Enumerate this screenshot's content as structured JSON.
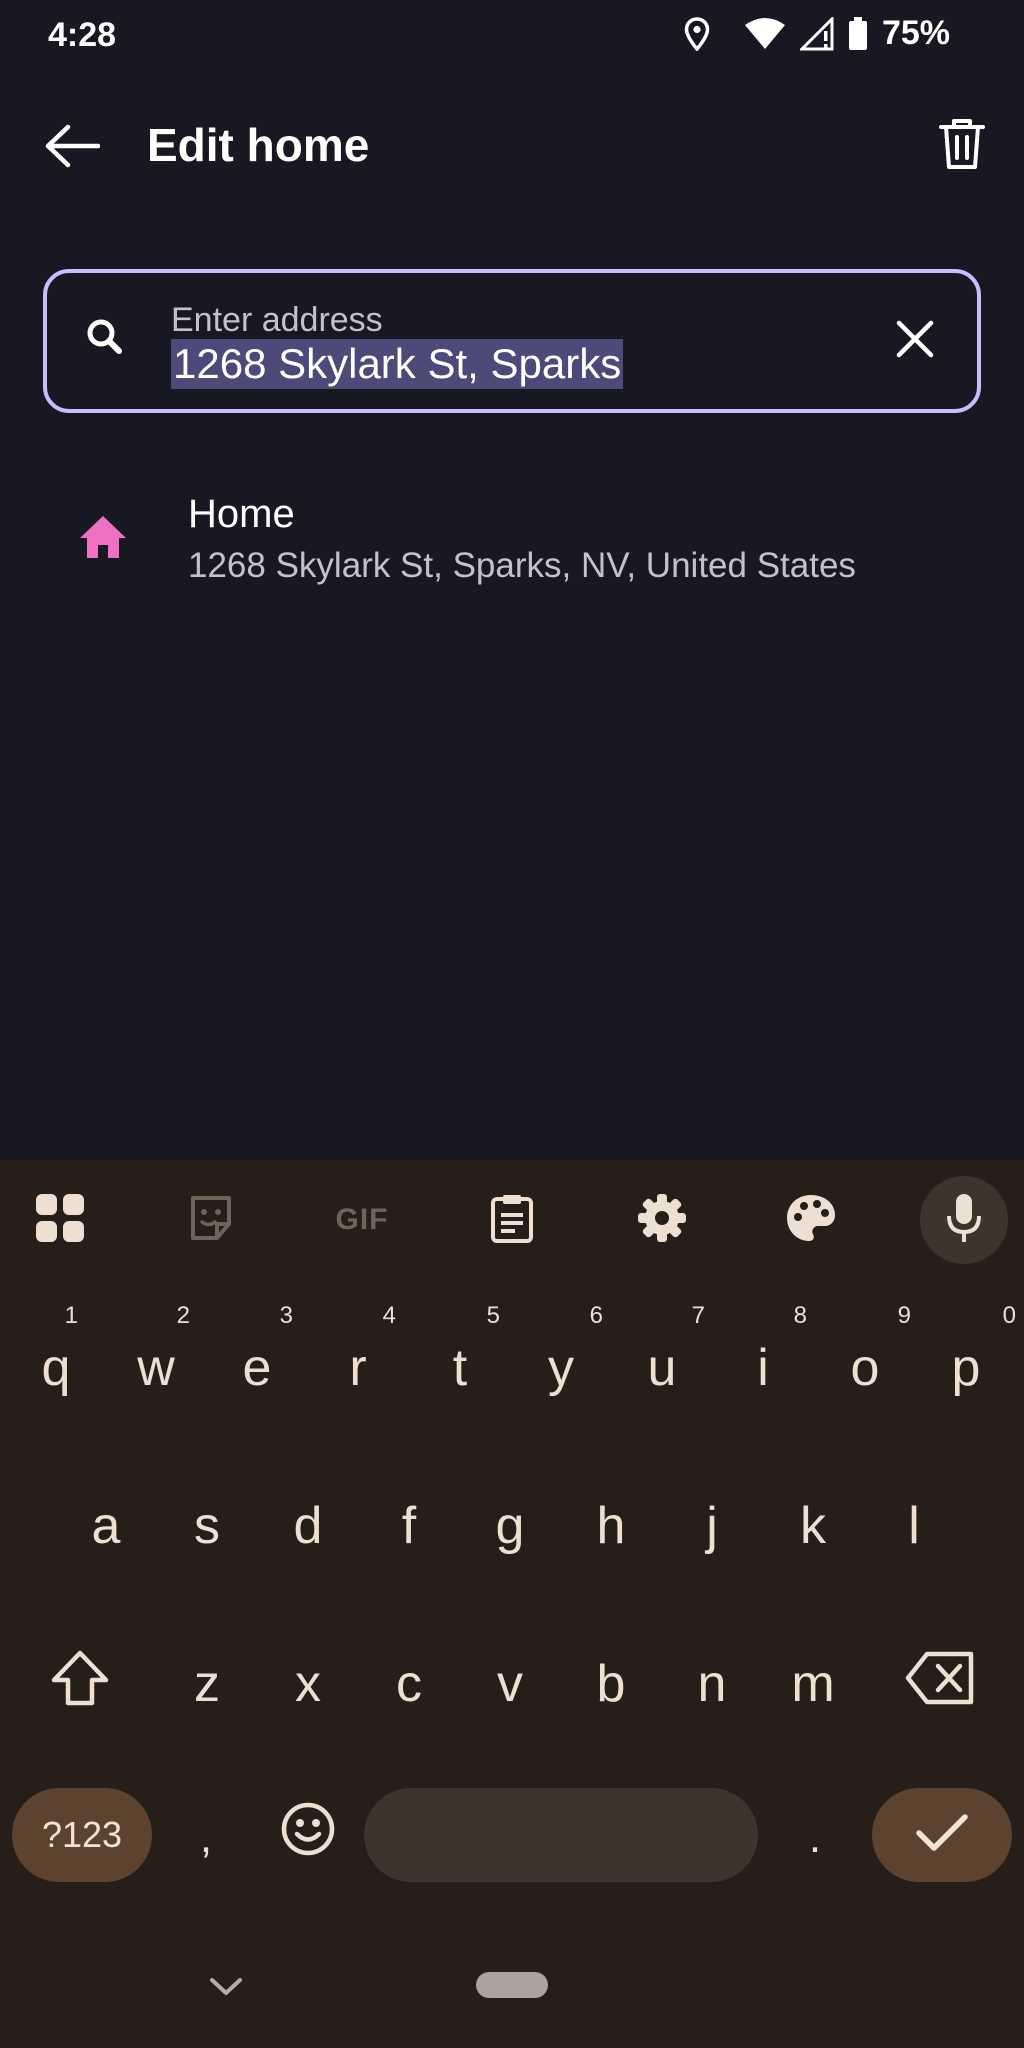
{
  "status_bar": {
    "time": "4:28",
    "battery": "75%"
  },
  "header": {
    "title": "Edit home"
  },
  "search": {
    "label": "Enter address",
    "value": "1268 Skylark St, Sparks"
  },
  "results": [
    {
      "title": "Home",
      "address": "1268 Skylark St, Sparks, NV, United States",
      "icon": "home-icon"
    }
  ],
  "keyboard": {
    "toolbar": {
      "gif_label": "GIF",
      "icons": [
        "apps-grid-icon",
        "sticker-icon",
        "gif-icon",
        "clipboard-icon",
        "settings-icon",
        "palette-icon",
        "microphone-icon"
      ]
    },
    "row1": [
      "q",
      "w",
      "e",
      "r",
      "t",
      "y",
      "u",
      "i",
      "o",
      "p"
    ],
    "row1_hints": [
      "1",
      "2",
      "3",
      "4",
      "5",
      "6",
      "7",
      "8",
      "9",
      "0"
    ],
    "row2": [
      "a",
      "s",
      "d",
      "f",
      "g",
      "h",
      "j",
      "k",
      "l"
    ],
    "row3": [
      "z",
      "x",
      "c",
      "v",
      "b",
      "n",
      "m"
    ],
    "symbols_label": "?123",
    "comma": ",",
    "period": "."
  },
  "colors": {
    "background": "#181822",
    "accent_outline": "#c9bcff",
    "home_icon": "#ef6fc3",
    "keyboard_bg": "#261e18",
    "key_accent": "#5c4330"
  }
}
